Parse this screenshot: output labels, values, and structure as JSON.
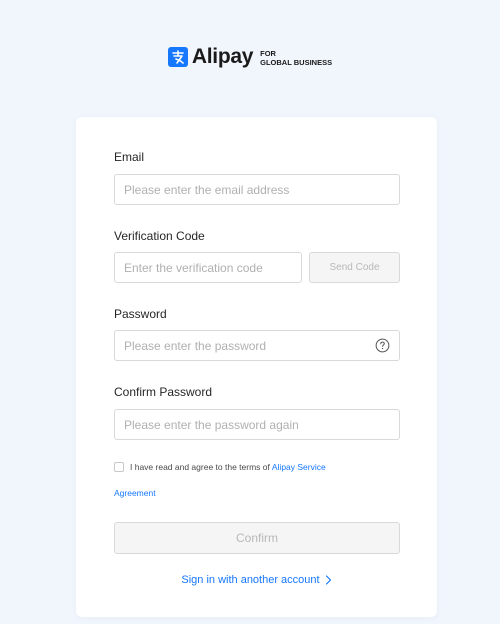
{
  "header": {
    "brand": "Alipay",
    "tagline_line1": "FOR",
    "tagline_line2": "GLOBAL BUSINESS",
    "logo_glyph": "支"
  },
  "form": {
    "email": {
      "label": "Email",
      "placeholder": "Please enter the email address"
    },
    "verification": {
      "label": "Verification Code",
      "placeholder": "Enter the verification code",
      "send_label": "Send Code"
    },
    "password": {
      "label": "Password",
      "placeholder": "Please enter the password"
    },
    "confirm_password": {
      "label": "Confirm Password",
      "placeholder": "Please enter the password again"
    },
    "agreement": {
      "text": "I have read and agree to the terms of ",
      "link_part1": "Alipay Service",
      "link_part2": "Agreement",
      "checked": false
    },
    "confirm_label": "Confirm",
    "other_account_label": "Sign in with another account"
  },
  "colors": {
    "accent": "#1677ff",
    "background": "#f1f5fc",
    "disabled_text": "#b8b8b8"
  },
  "icons": [
    "alipay-logo-icon",
    "help-circle-icon",
    "chevron-right-icon"
  ]
}
